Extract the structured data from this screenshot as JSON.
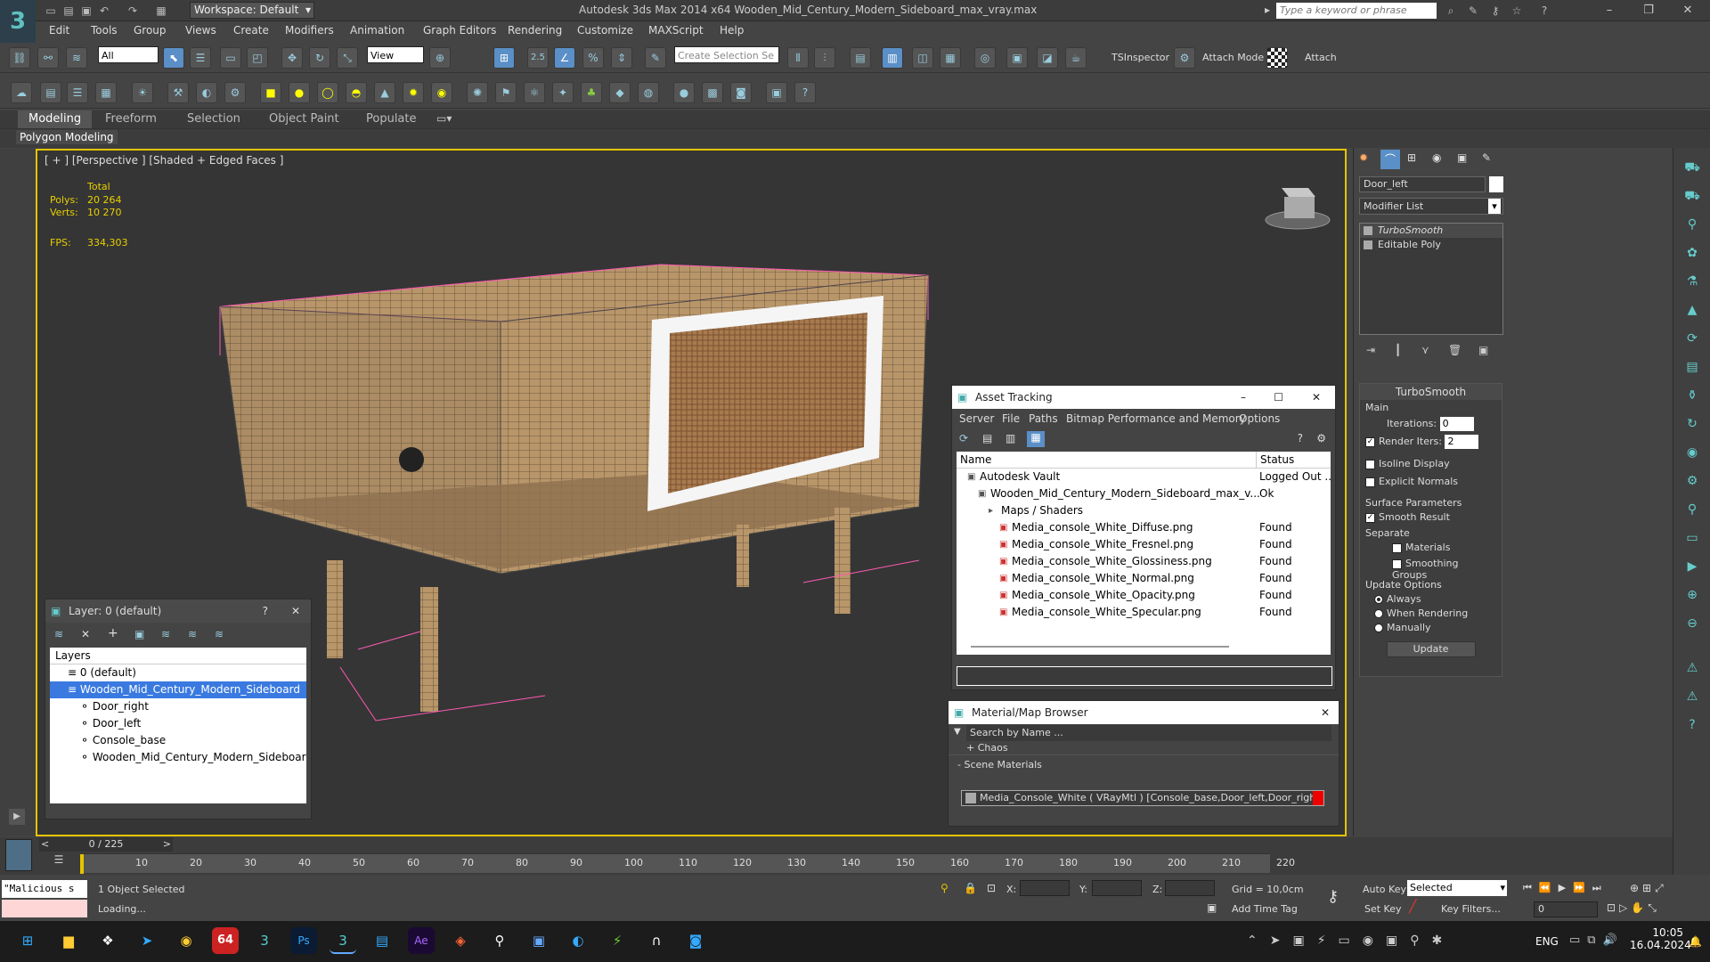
{
  "window": {
    "title": "Autodesk 3ds Max  2014 x64    Wooden_Mid_Century_Modern_Sideboard_max_vray.max",
    "workspace": "Workspace: Default",
    "search_placeholder": "Type a keyword or phrase"
  },
  "menu": [
    "Edit",
    "Tools",
    "Group",
    "Views",
    "Create",
    "Modifiers",
    "Animation",
    "Graph Editors",
    "Rendering",
    "Customize",
    "MAXScript",
    "Help"
  ],
  "toolbar": {
    "filter": "All",
    "ref_coord": "View",
    "snap_value": "2.5",
    "selection_set_placeholder": "Create Selection Se",
    "tsinspector": "TSInspector",
    "attach_mode": "Attach Mode",
    "attach": "Attach"
  },
  "ribbon": {
    "tabs": [
      "Modeling",
      "Freeform",
      "Selection",
      "Object Paint",
      "Populate"
    ],
    "active_tab": "Modeling",
    "sub_label": "Polygon Modeling"
  },
  "viewport": {
    "label": "[ + ] [Perspective ] [Shaded + Edged Faces ]",
    "stats_header": "Total",
    "polys_label": "Polys:",
    "polys_value": "20 264",
    "verts_label": "Verts:",
    "verts_value": "10 270",
    "fps_label": "FPS:",
    "fps_value": "334,303"
  },
  "layer_panel": {
    "title": "Layer: 0 (default)",
    "header": "Layers",
    "help": "?",
    "items": [
      {
        "label": "0 (default)",
        "indent": 0,
        "selected": false
      },
      {
        "label": "Wooden_Mid_Century_Modern_Sideboard",
        "indent": 0,
        "selected": true
      },
      {
        "label": "Door_right",
        "indent": 1,
        "selected": false
      },
      {
        "label": "Door_left",
        "indent": 1,
        "selected": false
      },
      {
        "label": "Console_base",
        "indent": 1,
        "selected": false
      },
      {
        "label": "Wooden_Mid_Century_Modern_Sideboard",
        "indent": 1,
        "selected": false
      }
    ]
  },
  "asset_tracking": {
    "title": "Asset Tracking",
    "menu": [
      "Server",
      "File",
      "Paths",
      "Bitmap Performance and Memory",
      "Options"
    ],
    "columns": [
      "Name",
      "Status"
    ],
    "rows": [
      {
        "name": "Autodesk Vault",
        "status": "Logged Out ...",
        "indent": 1
      },
      {
        "name": "Wooden_Mid_Century_Modern_Sideboard_max_v...",
        "status": "Ok",
        "indent": 2
      },
      {
        "name": "Maps / Shaders",
        "status": "",
        "indent": 3
      },
      {
        "name": "Media_console_White_Diffuse.png",
        "status": "Found",
        "indent": 4
      },
      {
        "name": "Media_console_White_Fresnel.png",
        "status": "Found",
        "indent": 4
      },
      {
        "name": "Media_console_White_Glossiness.png",
        "status": "Found",
        "indent": 4
      },
      {
        "name": "Media_console_White_Normal.png",
        "status": "Found",
        "indent": 4
      },
      {
        "name": "Media_console_White_Opacity.png",
        "status": "Found",
        "indent": 4
      },
      {
        "name": "Media_console_White_Specular.png",
        "status": "Found",
        "indent": 4
      }
    ]
  },
  "material_browser": {
    "title": "Material/Map Browser",
    "search_placeholder": "Search by Name ...",
    "group_chaos": "+ Chaos",
    "group_scene": "- Scene Materials",
    "material": "Media_Console_White ( VRayMtl ) [Console_base,Door_left,Door_right]"
  },
  "command_panel": {
    "object_name": "Door_left",
    "modifier_list": "Modifier List",
    "stack": [
      "TurboSmooth",
      "Editable Poly"
    ],
    "rollout_title": "TurboSmooth",
    "main_label": "Main",
    "iterations_label": "Iterations:",
    "iterations_value": "0",
    "render_iters_label": "Render Iters:",
    "render_iters_value": "2",
    "isoline": "Isoline Display",
    "explicit_normals": "Explicit Normals",
    "surface_params": "Surface Parameters",
    "smooth_result": "Smooth Result",
    "separate": "Separate",
    "materials": "Materials",
    "smoothing_groups": "Smoothing Groups",
    "update_options": "Update Options",
    "always": "Always",
    "when_rendering": "When Rendering",
    "manually": "Manually",
    "update_btn": "Update"
  },
  "timeline": {
    "frame_counter": "0 / 225",
    "ticks": [
      "10",
      "20",
      "30",
      "40",
      "50",
      "60",
      "70",
      "80",
      "90",
      "100",
      "110",
      "120",
      "130",
      "140",
      "150",
      "160",
      "170",
      "180",
      "190",
      "200",
      "210",
      "220"
    ]
  },
  "status": {
    "maxscript": "\"Malicious s",
    "selected": "1 Object Selected",
    "loading": "Loading...",
    "x_label": "X:",
    "y_label": "Y:",
    "z_label": "Z:",
    "grid": "Grid = 10,0cm",
    "add_time_tag": "Add Time Tag",
    "auto_key": "Auto Key",
    "set_key": "Set Key",
    "selected_dd": "Selected",
    "key_filters": "Key Filters...",
    "frame": "0"
  },
  "taskbar": {
    "lang": "ENG",
    "time": "10:05",
    "date": "16.04.2024",
    "badge": "64"
  }
}
